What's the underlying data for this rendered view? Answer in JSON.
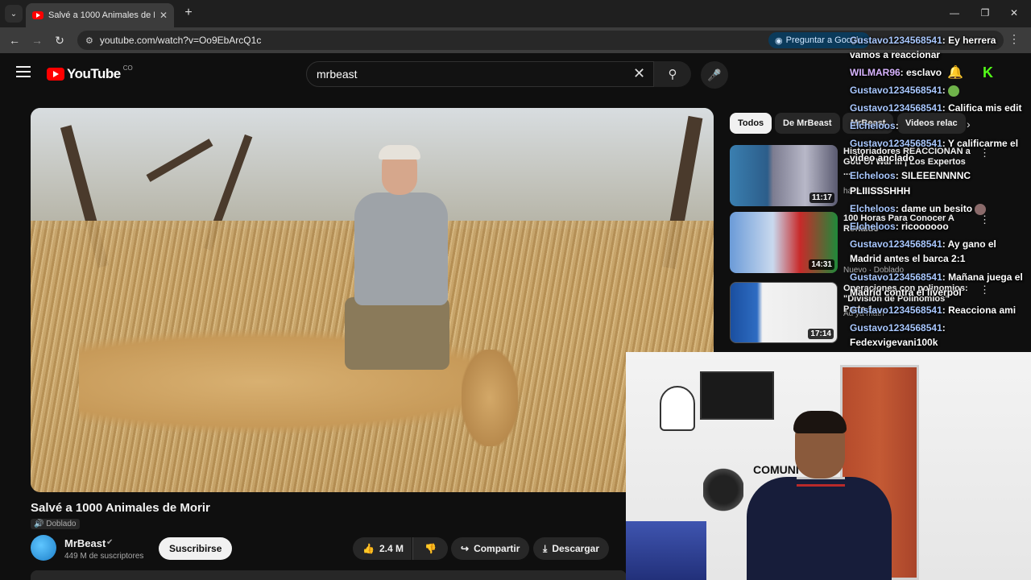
{
  "browser": {
    "tab_title": "Salvé a 1000 Animales de Morir",
    "new_tab_label": "+",
    "url": "youtube.com/watch?v=Oo9EbArcQ1c",
    "ask_google": "Preguntar a Google"
  },
  "masthead": {
    "logo_text": "YouTube",
    "country_code": "CO",
    "search_value": "mrbeast"
  },
  "video": {
    "title": "Salvé a 1000 Animales de Morir",
    "dub_badge": "Doblado",
    "channel_name": "MrBeast",
    "subscribers": "449 M de suscriptores",
    "subscribe_label": "Suscribirse",
    "likes": "2.4 M",
    "share_label": "Compartir",
    "download_label": "Descargar"
  },
  "sidebar": {
    "chips": [
      "Todos",
      "De MrBeast",
      "MrBeast",
      "Videos relac"
    ],
    "videos": [
      {
        "title": "Historiadores REACCIONAN a God Of War III | Los Expertos ...",
        "meta": "hace 3 años",
        "duration": "11:17"
      },
      {
        "title": "100 Horas Para Conocer A Ronaldo",
        "meta": "Nuevo · Doblado",
        "duration": "14:31"
      },
      {
        "title": "Operaciones con polinomios: \"División de Polinomios\" Parte 1",
        "meta": "Ad ya math",
        "duration": "17:14"
      }
    ]
  },
  "chat": {
    "lines": [
      {
        "user": "Gustavo1234568541",
        "msg": ": Ey herrera"
      },
      {
        "user": "",
        "msg": "vamos a reaccionar"
      },
      {
        "user": "WILMAR96",
        "msg": ": esclavo"
      },
      {
        "user": "Gustavo1234568541",
        "msg": ":"
      },
      {
        "user": "Gustavo1234568541",
        "msg": ": Califica mis edit"
      },
      {
        "user": "Elcheloos",
        "msg": ":"
      },
      {
        "user": "Gustavo1234568541",
        "msg": ": Y calificarme el"
      },
      {
        "user": "",
        "msg": "video anclado"
      },
      {
        "user": "Elcheloos",
        "msg": ": SILEEENNNNC"
      },
      {
        "user": "",
        "msg": "PLIIISSSHHH"
      },
      {
        "user": "Elcheloos",
        "msg": ": dame un besito"
      },
      {
        "user": "Elcheloos",
        "msg": ": ricoooooo"
      },
      {
        "user": "Gustavo1234568541",
        "msg": ": Ay gano el"
      },
      {
        "user": "",
        "msg": "Madrid antes el barca 2:1"
      },
      {
        "user": "Gustavo1234568541",
        "msg": ": Mañana juega el"
      },
      {
        "user": "",
        "msg": "Madrid contra el liverpol"
      },
      {
        "user": "Gustavo1234568541",
        "msg": ": Reacciona ami"
      },
      {
        "user": "Gustavo1234568541",
        "msg": ":"
      },
      {
        "user": "",
        "msg": "Fedexvigevani100k"
      }
    ]
  },
  "webcam": {
    "sticker_text": "COMUNI"
  },
  "colors": {
    "youtube_red": "#ff0000",
    "kick_green": "#53fc18",
    "chat_username": "#a9c8ff"
  }
}
